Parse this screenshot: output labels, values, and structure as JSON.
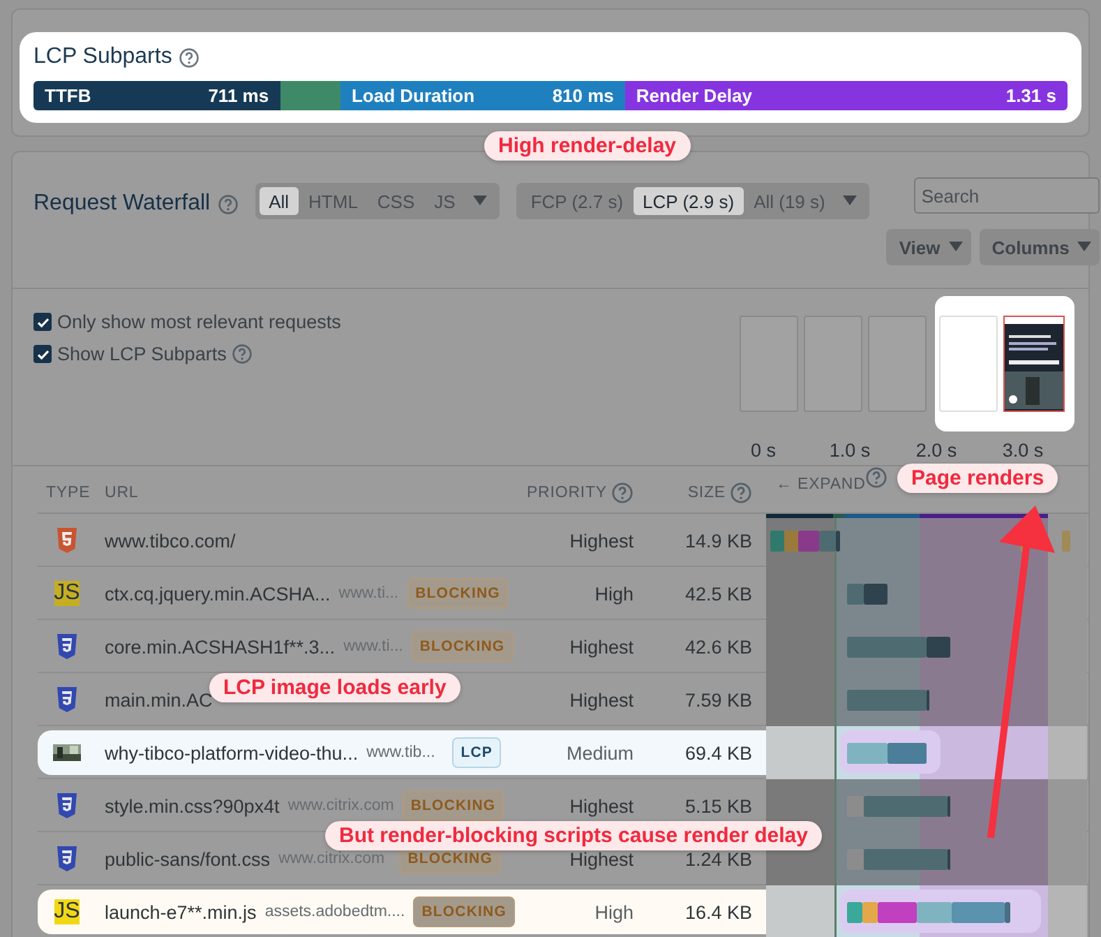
{
  "lcp_subparts": {
    "title": "LCP Subparts",
    "segments": [
      {
        "label": "TTFB",
        "value": "711 ms",
        "color": "#163a56"
      },
      {
        "color": "#3e8a68"
      },
      {
        "label": "Load Duration",
        "value": "810 ms",
        "color": "#1f80c0"
      },
      {
        "label": "Render Delay",
        "value": "1.31 s",
        "color": "#8634e0"
      }
    ]
  },
  "waterfall": {
    "title": "Request Waterfall",
    "type_filters": [
      {
        "label": "All",
        "selected": true
      },
      {
        "label": "HTML",
        "selected": false
      },
      {
        "label": "CSS",
        "selected": false
      },
      {
        "label": "JS",
        "selected": false
      }
    ],
    "time_filters": [
      {
        "label": "FCP (2.7 s)",
        "selected": false
      },
      {
        "label": "LCP (2.9 s)",
        "selected": true
      },
      {
        "label": "All (19 s)",
        "selected": false
      }
    ],
    "search": {
      "placeholder": "Search"
    },
    "buttons": [
      "View",
      "Columns"
    ],
    "options": [
      {
        "label": "Only show most relevant requests",
        "checked": true,
        "help": false
      },
      {
        "label": "Show LCP Subparts",
        "checked": true,
        "help": true
      }
    ],
    "filmstrip": {
      "frames": [
        {
          "rendered": false,
          "highlighted": false
        },
        {
          "rendered": false,
          "highlighted": false
        },
        {
          "rendered": false,
          "highlighted": false
        },
        {
          "rendered": false,
          "highlighted": true
        },
        {
          "rendered": true,
          "highlighted": true
        }
      ],
      "times": [
        "0 s",
        "1.0 s",
        "2.0 s",
        "3.0 s"
      ]
    },
    "columns": [
      {
        "label": "TYPE",
        "help": false
      },
      {
        "label": "URL",
        "help": false
      },
      {
        "label": "PRIORITY",
        "help": true
      },
      {
        "label": "SIZE",
        "help": true
      },
      {
        "label": "← EXPAND",
        "help": true
      }
    ],
    "rows": [
      {
        "kind": "html",
        "url": "www.tibco.com/",
        "priority": "Highest",
        "size": "14.9 KB",
        "highlighted": false
      },
      {
        "kind": "js",
        "type_label": "JS",
        "url": "ctx.cq.jquery.min.ACSHA...",
        "domain": "www.ti...",
        "badge": "BLOCKING",
        "priority": "High",
        "size": "42.5 KB",
        "highlighted": false
      },
      {
        "kind": "css",
        "url": "core.min.ACSHASH1f**.3...",
        "domain": "www.ti...",
        "badge": "BLOCKING",
        "priority": "Highest",
        "size": "42.6 KB",
        "highlighted": false
      },
      {
        "kind": "css",
        "url": "main.min.AC",
        "priority": "Highest",
        "size": "7.59 KB",
        "highlighted": false
      },
      {
        "url": "why-tibco-platform-video-thu...",
        "domain": "www.tib...",
        "badge": "LCP",
        "priority": "Medium",
        "size": "69.4 KB",
        "highlighted": true
      },
      {
        "kind": "css",
        "url": "style.min.css?90px4t",
        "domain": "www.citrix.com",
        "badge": "BLOCKING",
        "priority": "Highest",
        "size": "5.15 KB",
        "highlighted": false
      },
      {
        "kind": "css",
        "url": "public-sans/font.css",
        "domain": "www.citrix.com",
        "badge": "BLOCKING",
        "priority": "Highest",
        "size": "1.24 KB",
        "highlighted": false
      },
      {
        "kind": "js",
        "type_label": "JS",
        "url": "launch-e7**.min.js",
        "domain": "assets.adobedtm....",
        "badge": "BLOCKING",
        "priority": "High",
        "size": "16.4 KB",
        "highlighted": true
      }
    ]
  },
  "callouts": [
    {
      "text": "High render-delay"
    },
    {
      "text": "Page renders"
    },
    {
      "text": "LCP image loads early"
    },
    {
      "text": "But render-blocking scripts cause render delay"
    }
  ]
}
